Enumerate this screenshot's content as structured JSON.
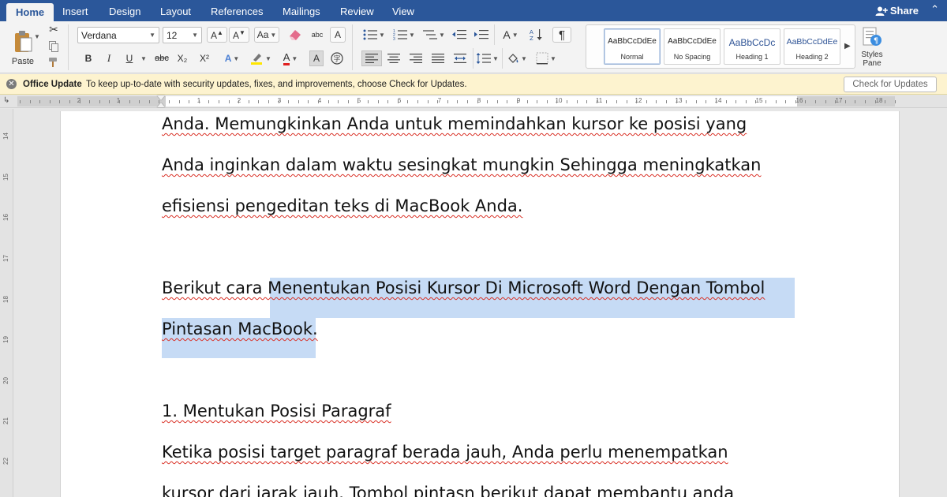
{
  "tabs": [
    "Home",
    "Insert",
    "Design",
    "Layout",
    "References",
    "Mailings",
    "Review",
    "View"
  ],
  "share_label": "Share",
  "ribbon": {
    "paste_label": "Paste",
    "font_name": "Verdana",
    "font_size": "12",
    "bold": "B",
    "italic": "I",
    "underline": "U",
    "strikethrough": "abc",
    "subscript": "X₂",
    "superscript": "X²",
    "clear_format_label": "abc",
    "styles": [
      {
        "sample": "AaBbCcDdEe",
        "label": "Normal"
      },
      {
        "sample": "AaBbCcDdEe",
        "label": "No Spacing"
      },
      {
        "sample": "AaBbCcDc",
        "label": "Heading 1"
      },
      {
        "sample": "AaBbCcDdEe",
        "label": "Heading 2"
      }
    ],
    "styles_pane_label": "Styles Pane"
  },
  "message_bar": {
    "title": "Office Update",
    "text": "To keep up-to-date with security updates, fixes, and improvements, choose Check for Updates.",
    "button": "Check for Updates"
  },
  "ruler": {
    "h_labels": [
      "2",
      "1",
      "1",
      "2",
      "3",
      "4",
      "5",
      "6",
      "7",
      "8",
      "9",
      "10",
      "11",
      "12",
      "13",
      "14",
      "15",
      "16",
      "17",
      "18"
    ],
    "v_labels": [
      "14",
      "15",
      "16",
      "17",
      "18",
      "19",
      "20",
      "21",
      "22"
    ]
  },
  "document": {
    "lines": [
      "Anda. Memungkinkan Anda untuk memindahkan kursor ke posisi yang",
      "Anda inginkan dalam waktu sesingkat mungkin Sehingga meningkatkan",
      "efisiensi pengeditan teks di MacBook Anda.",
      "Berikut cara Menentukan Posisi Kursor Di Microsoft Word Dengan Tombol",
      "Pintasan MacBook.",
      "1. Mentukan Posisi Paragraf",
      "Ketika posisi target paragraf berada jauh, Anda perlu menempatkan",
      "kursor dari jarak jauh. Tombol pintasn berikut dapat membantu anda"
    ]
  },
  "colors": {
    "tab_bar": "#2b579a",
    "ribbon_bg": "#f3f3f3",
    "message_bar_bg": "#fdf3cf",
    "selection": "#c6dbf5",
    "spell_underline": "#d93025"
  }
}
